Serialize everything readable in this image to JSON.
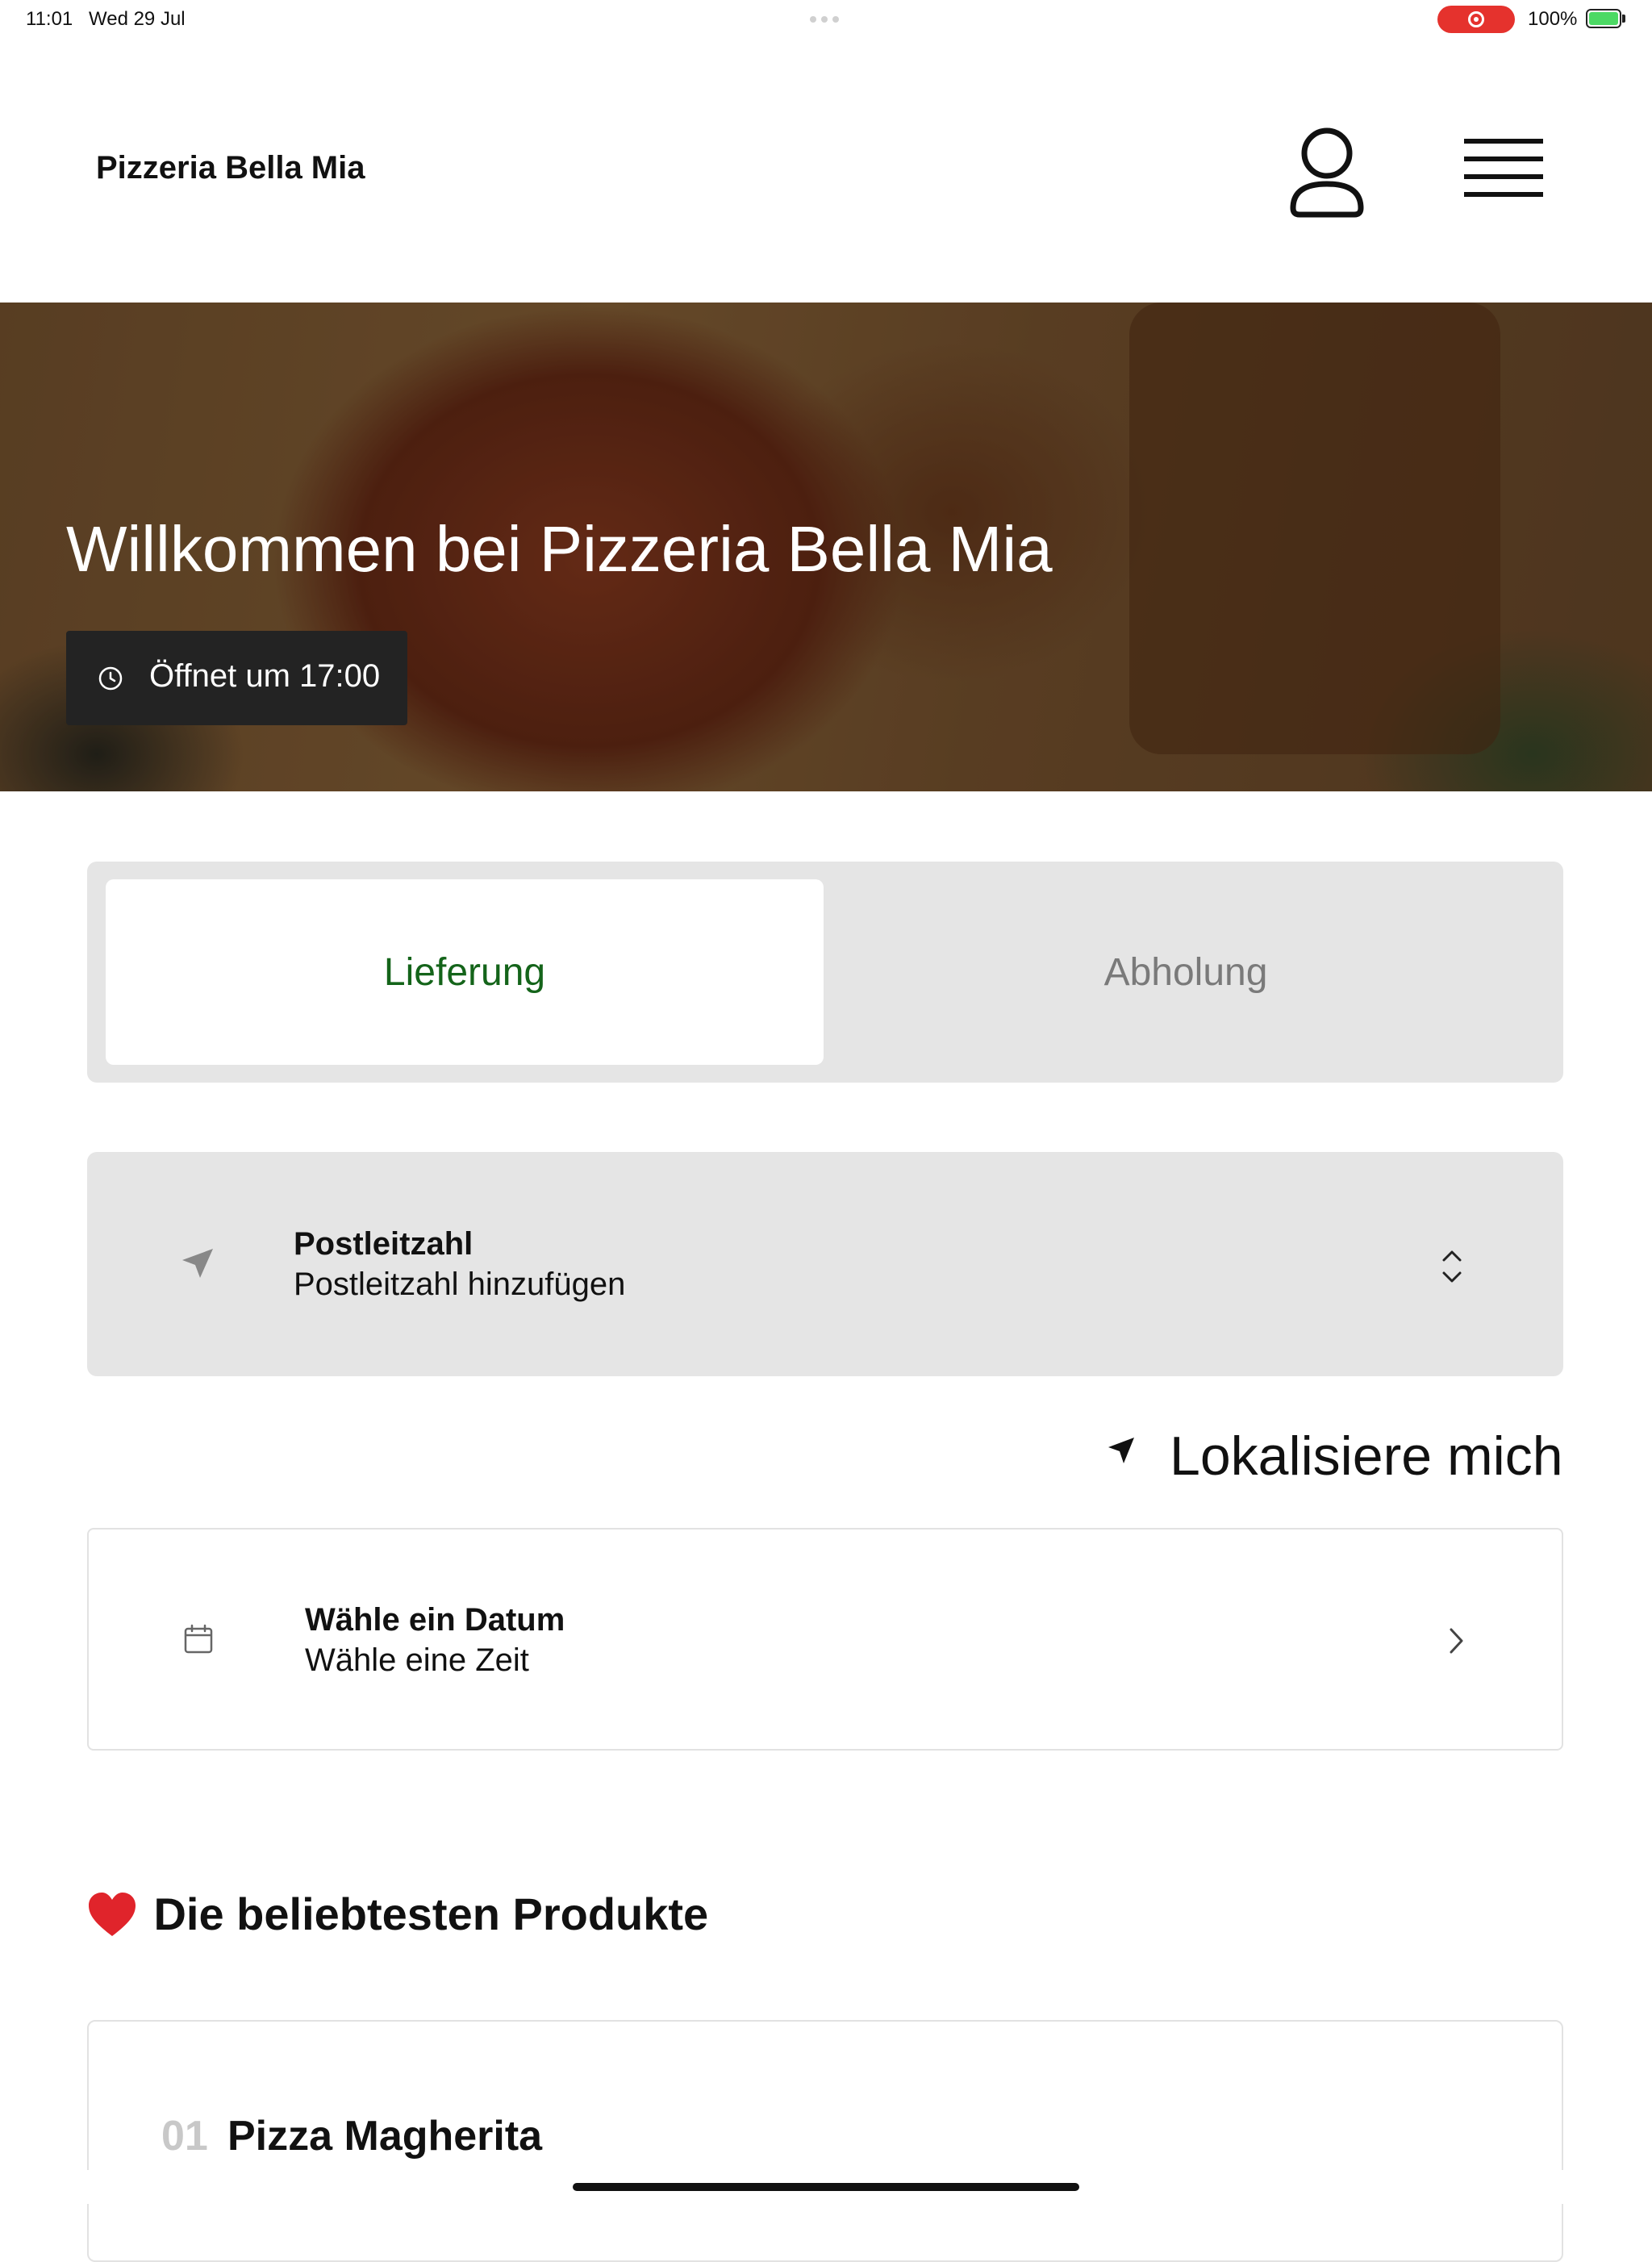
{
  "status_bar": {
    "time": "11:01",
    "date": "Wed 29 Jul",
    "battery_percent": "100%",
    "recording_color": "#e5322d",
    "battery_color": "#4cd964"
  },
  "header": {
    "brand": "Pizzeria Bella Mia",
    "profile_icon": "person-icon",
    "menu_icon": "hamburger-menu-icon"
  },
  "hero": {
    "title": "Willkommen bei Pizzeria Bella Mia",
    "opening_badge": "Öffnet um 17:00",
    "badge_icon": "clock-icon"
  },
  "order_mode": {
    "tabs": [
      {
        "label": "Lieferung",
        "active": true
      },
      {
        "label": "Abholung",
        "active": false
      }
    ],
    "active_color": "#14641a"
  },
  "postcode": {
    "label": "Postleitzahl",
    "placeholder": "Postleitzahl hinzufügen",
    "icon": "location-arrow-icon"
  },
  "locate_me": {
    "label": "Lokalisiere mich",
    "icon": "location-arrow-icon"
  },
  "schedule": {
    "label": "Wähle ein Datum",
    "sublabel": "Wähle eine Zeit",
    "icon": "calendar-icon"
  },
  "popular": {
    "title": "Die beliebtesten Produkte",
    "icon": "heart-icon",
    "products": [
      {
        "number": "01",
        "name": "Pizza Magherita"
      }
    ]
  }
}
